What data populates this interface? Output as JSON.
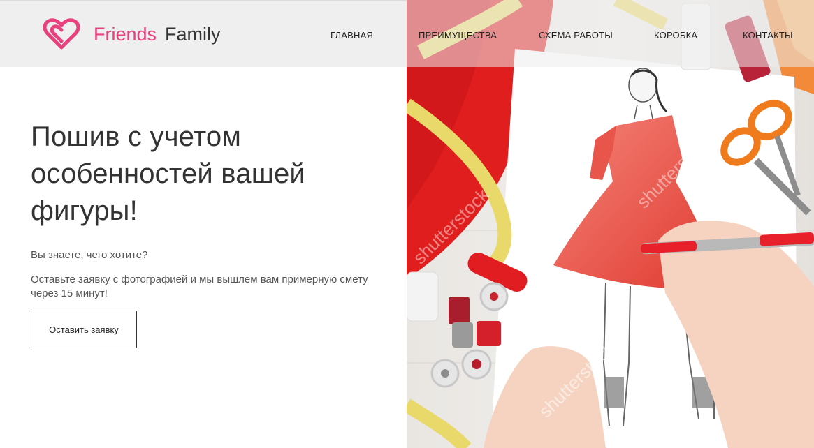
{
  "header": {
    "logo": {
      "word1": "Friends",
      "word2": "Family",
      "icon": "double-heart-icon"
    },
    "nav": [
      {
        "label": "ГЛАВНАЯ"
      },
      {
        "label": "ПРЕИМУЩЕСТВА"
      },
      {
        "label": "СХЕМА РАБОТЫ"
      },
      {
        "label": "КОРОБКА"
      },
      {
        "label": "КОНТАКТЫ"
      }
    ]
  },
  "hero": {
    "title": "Пошив с учетом особенностей вашей фигуры!",
    "question": "Вы знаете, чего хотите?",
    "description": "Оставьте заявку с фотографией и мы вышлем вам примерную смету через 15 минут!",
    "cta_label": "Оставить заявку",
    "image": {
      "watermark": "shutterstock",
      "subject": "fashion sketch of red dress with sewing supplies"
    }
  },
  "colors": {
    "brand_pink": "#e8417d",
    "text_dark": "#333333",
    "header_bg": "#efefef",
    "fabric_red": "#e01e1e"
  }
}
